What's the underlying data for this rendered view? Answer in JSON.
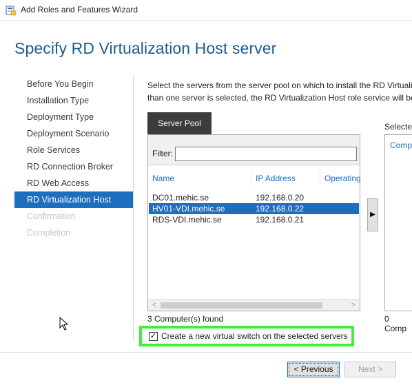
{
  "window": {
    "title": "Add Roles and Features Wizard"
  },
  "page": {
    "heading": "Specify RD Virtualization Host server",
    "description_line1": "Select the servers from the server pool on which to install the RD Virtuali",
    "description_line2": "than one server is selected, the RD Virtualization Host role service will be"
  },
  "nav": {
    "items": [
      {
        "label": "Before You Begin",
        "state": "normal"
      },
      {
        "label": "Installation Type",
        "state": "normal"
      },
      {
        "label": "Deployment Type",
        "state": "normal"
      },
      {
        "label": "Deployment Scenario",
        "state": "normal"
      },
      {
        "label": "Role Services",
        "state": "normal"
      },
      {
        "label": "RD Connection Broker",
        "state": "normal"
      },
      {
        "label": "RD Web Access",
        "state": "normal"
      },
      {
        "label": "RD Virtualization Host",
        "state": "active"
      },
      {
        "label": "Confirmation",
        "state": "disabled"
      },
      {
        "label": "Completion",
        "state": "disabled"
      }
    ]
  },
  "server_pool": {
    "tab_label": "Server Pool",
    "filter_label": "Filter:",
    "filter_value": "",
    "columns": [
      "Name",
      "IP Address",
      "Operating"
    ],
    "rows": [
      {
        "name": "DC01.mehic.se",
        "ip": "192.168.0.20",
        "selected": false
      },
      {
        "name": "HV01-VDI.mehic.se",
        "ip": "192.168.0.22",
        "selected": true
      },
      {
        "name": "RDS-VDI.mehic.se",
        "ip": "192.168.0.21",
        "selected": false
      }
    ],
    "count_text": "3 Computer(s) found"
  },
  "selected_panel": {
    "label": "Selected",
    "column": "Comp",
    "count_text": "0 Comp"
  },
  "move_button": {
    "glyph": "▶"
  },
  "virtual_switch": {
    "checked": true,
    "check_glyph": "✓",
    "label": "Create a new virtual switch on the selected servers",
    "highlight_color": "#3ef03a"
  },
  "footer": {
    "previous_label": "< Previous",
    "next_label": "Next >"
  },
  "colors": {
    "accent": "#1e6ebf",
    "heading": "#1c5d8f",
    "tab": "#3c3c3c"
  }
}
